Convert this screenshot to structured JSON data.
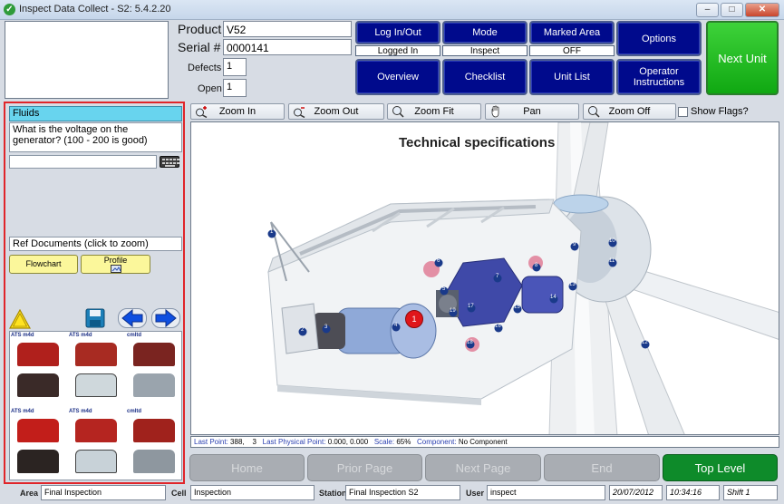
{
  "window": {
    "title": "Inspect Data Collect - S2: 5.4.2.20",
    "controls": {
      "minimize": "–",
      "maximize": "□",
      "close": "✕"
    }
  },
  "header": {
    "product_label": "Product",
    "product_value": "V52",
    "serial_label": "Serial #",
    "serial_value": "0000141",
    "defects_label": "Defects",
    "defects_value": "1",
    "open_label": "Open",
    "open_value": "1"
  },
  "buttons": {
    "login": "Log In/Out",
    "login_status": "Logged In",
    "mode": "Mode",
    "mode_status": "Inspect",
    "marked_area": "Marked Area",
    "marked_area_status": "OFF",
    "options": "Options",
    "overview": "Overview",
    "checklist": "Checklist",
    "unit_list": "Unit List",
    "operator_instructions": "Operator Instructions",
    "next_unit": "Next Unit"
  },
  "left_panel": {
    "category": "Fluids",
    "question": "What is the voltage on the generator? (100 - 200 is good)",
    "answer_value": "",
    "ref_documents": "Ref Documents (click to zoom)",
    "flowchart": "Flowchart",
    "profile": "Profile",
    "thumb_head": "ATS m4d",
    "thumb_brand": "cmltd"
  },
  "toolbar": {
    "zoom_in": "Zoom In",
    "zoom_out": "Zoom Out",
    "zoom_fit": "Zoom Fit",
    "pan": "Pan",
    "zoom_off": "Zoom Off",
    "show_flags": "Show Flags?"
  },
  "viewer": {
    "title": "Technical specifications",
    "defect_marker": "1",
    "callouts": [
      "1",
      "2",
      "3",
      "4",
      "5",
      "6",
      "7",
      "8",
      "9",
      "10",
      "11",
      "12",
      "13",
      "14",
      "15",
      "16",
      "17",
      "18",
      "19"
    ]
  },
  "statusline": {
    "last_point_label": "Last Point:",
    "last_point_value": "388,    3",
    "last_physical_label": "Last Physical Point:",
    "last_physical_value": "0.000, 0.000",
    "scale_label": "Scale:",
    "scale_value": "65%",
    "component_label": "Component:",
    "component_value": "No Component"
  },
  "bottom_nav": {
    "home": "Home",
    "prior_page": "Prior Page",
    "next_page": "Next Page",
    "end": "End",
    "top_level": "Top Level"
  },
  "footer": {
    "area_label": "Area",
    "area_value": "Final Inspection",
    "cell_label": "Cell",
    "cell_value": "Inspection",
    "station_label": "Station",
    "station_value": "Final Inspection S2",
    "user_label": "User",
    "user_value": "inspect",
    "date_value": "20/07/2012",
    "time_value": "10:34:16",
    "shift_value": "Shift 1"
  },
  "colors": {
    "nav_button": "#000a8c",
    "next_unit": "#10a812",
    "top_level": "#0e8b2a",
    "highlight_border": "#e0252a",
    "category_bar": "#68d4ee",
    "defect_marker": "#e0161a"
  }
}
